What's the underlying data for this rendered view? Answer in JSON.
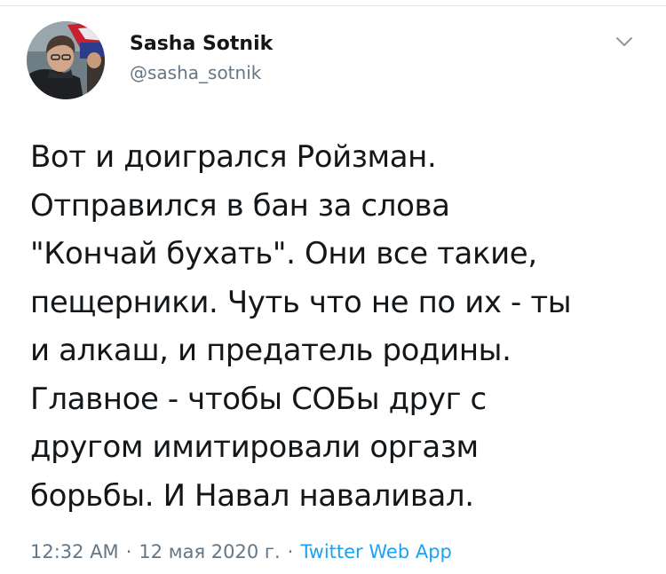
{
  "tweet": {
    "author": {
      "display_name": "Sasha Sotnik",
      "handle": "@sasha_sotnik"
    },
    "text_lines": [
      "Вот и доигрался Ройзман.",
      "Отправился в бан за слова",
      "\"Кончай бухать\". Они все такие,",
      "пещерники. Чуть что не по их - ты",
      "и алкаш, и предатель родины.",
      "Главное - чтобы СОБы друг с",
      "другом имитировали оргазм",
      "борьбы. И Навал наваливал."
    ],
    "time": "12:32 AM",
    "date": "12 мая 2020 г.",
    "separator": "·",
    "source": "Twitter Web App"
  },
  "icons": {
    "more_menu": "chevron-down-icon",
    "avatar": "profile-photo"
  },
  "colors": {
    "text_primary": "#14171a",
    "text_secondary": "#657786",
    "link": "#1da1f2",
    "divider": "#e1e8ed"
  }
}
